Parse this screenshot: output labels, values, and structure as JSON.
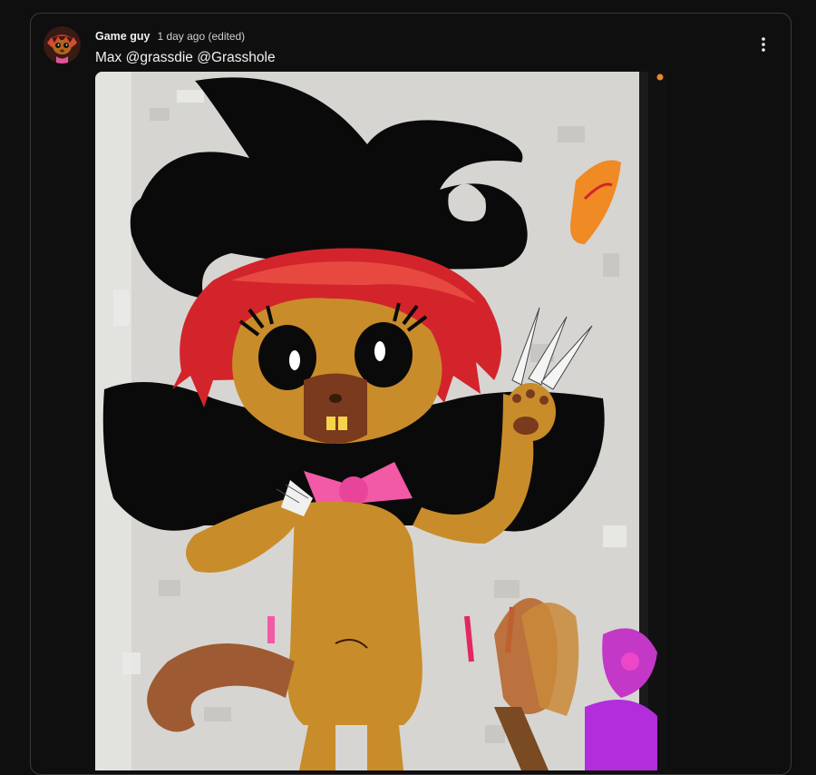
{
  "comment": {
    "author": "Game guy",
    "timestamp": "1 day ago (edited)",
    "text": "Max @grassdie @Grasshole",
    "menu_icon": "more-vert-icon",
    "avatar_icon": "avatar-creature-icon"
  },
  "attachment": {
    "kind": "image",
    "subject": "drawing"
  },
  "colors": {
    "background": "#0f0f0f",
    "card_border": "#3a3a3a",
    "text_primary": "#f1f1f1",
    "text_secondary": "#cfcfcf"
  }
}
